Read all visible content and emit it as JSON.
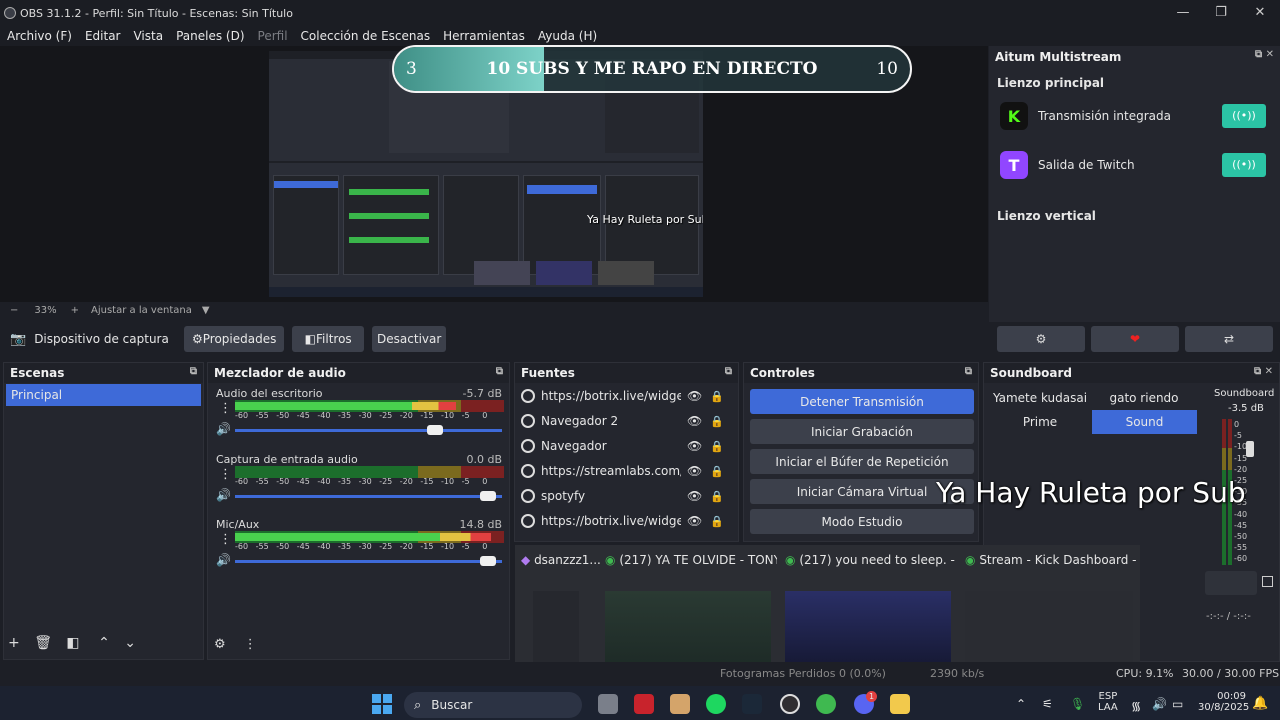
{
  "window": {
    "title": "OBS 31.1.2 - Perfil: Sin Título - Escenas: Sin Título"
  },
  "menu": [
    "Archivo (F)",
    "Editar",
    "Vista",
    "Paneles (D)",
    "Perfil",
    "Colección de Escenas",
    "Herramientas",
    "Ayuda (H)"
  ],
  "preview": {
    "subgoal_start": "3",
    "subgoal_text": "10 SUBS Y ME RAPO EN DIRECTO",
    "subgoal_end": "10",
    "subgoal_progress": 0.29,
    "ruleta_small": "Ya Hay Ruleta por Sub",
    "zoom_minus": "−",
    "zoom": "33%",
    "zoom_plus": "+",
    "fit": "Ajustar a la ventana"
  },
  "sourcebar": {
    "source": "Dispositivo de captura de v",
    "properties": "Propiedades",
    "filters": "Filtros",
    "deactivate": "Desactivar"
  },
  "multistream": {
    "title": "Aitum Multistream",
    "main_canvas": "Lienzo principal",
    "outputs": [
      {
        "name": "Transmisión integrada",
        "logo": "K",
        "color": "#53fc18"
      },
      {
        "name": "Salida de Twitch",
        "logo": "T",
        "color": "#9146ff"
      }
    ],
    "vertical_canvas": "Lienzo vertical",
    "toggle": "((•))"
  },
  "scenes": {
    "title": "Escenas",
    "items": [
      "Principal"
    ]
  },
  "mixer": {
    "title": "Mezclador de audio",
    "ticks": [
      "-60",
      "-55",
      "-50",
      "-45",
      "-40",
      "-35",
      "-30",
      "-25",
      "-20",
      "-15",
      "-10",
      "-5",
      "0"
    ],
    "channels": [
      {
        "name": "Audio del escritorio",
        "db": "-5.7 dB",
        "level": 0.82,
        "volume": 0.76
      },
      {
        "name": "Captura de entrada audio",
        "db": "0.0 dB",
        "level": 0.0,
        "volume": 0.97
      },
      {
        "name": "Mic/Aux",
        "db": "14.8 dB",
        "level": 0.95,
        "volume": 0.97
      }
    ]
  },
  "sources": {
    "title": "Fuentes",
    "items": [
      "https://botrix.live/widgets/g",
      "Navegador 2",
      "Navegador",
      "https://streamlabs.com/ale",
      "spotyfy",
      "https://botrix.live/widgets/e"
    ]
  },
  "controls": {
    "title": "Controles",
    "buttons": [
      "Detener Transmisión",
      "Iniciar Grabación",
      "Iniciar el Búfer de Repetición",
      "Iniciar Cámara Virtual",
      "Modo Estudio"
    ]
  },
  "soundboard": {
    "title": "Soundboard",
    "buttons": [
      "Yamete kudasai",
      "gato riendo",
      "Prime",
      "Sound"
    ],
    "meter_label": "Soundboard",
    "meter_db": "-3.5 dB",
    "meter_ticks": [
      "0",
      "-5",
      "-10",
      "-15",
      "-20",
      "-25",
      "-30",
      "-35",
      "-40",
      "-45",
      "-50",
      "-55",
      "-60"
    ],
    "timer": "-:-:-  /  -:-:-"
  },
  "overlay": {
    "ruleta": "Ya Hay Ruleta por Sub"
  },
  "thumbnails": [
    {
      "title": "dsanzzz1..."
    },
    {
      "title": "(217) YA TE OLVIDE - TONY..."
    },
    {
      "title": "(217) you need to sleep. - Y..."
    },
    {
      "title": "Stream - Kick Dashboard -..."
    }
  ],
  "status": {
    "frames": "Fotogramas Perdidos 0 (0.0%)",
    "kbps": "2390 kb/s",
    "cpu": "CPU: 9.1%",
    "fps": "30.00 / 30.00 FPS"
  },
  "taskbar": {
    "search": "Buscar",
    "lang1": "ESP",
    "lang2": "LAA",
    "time": "00:09",
    "date": "30/8/2025",
    "discord_badge": "1"
  }
}
